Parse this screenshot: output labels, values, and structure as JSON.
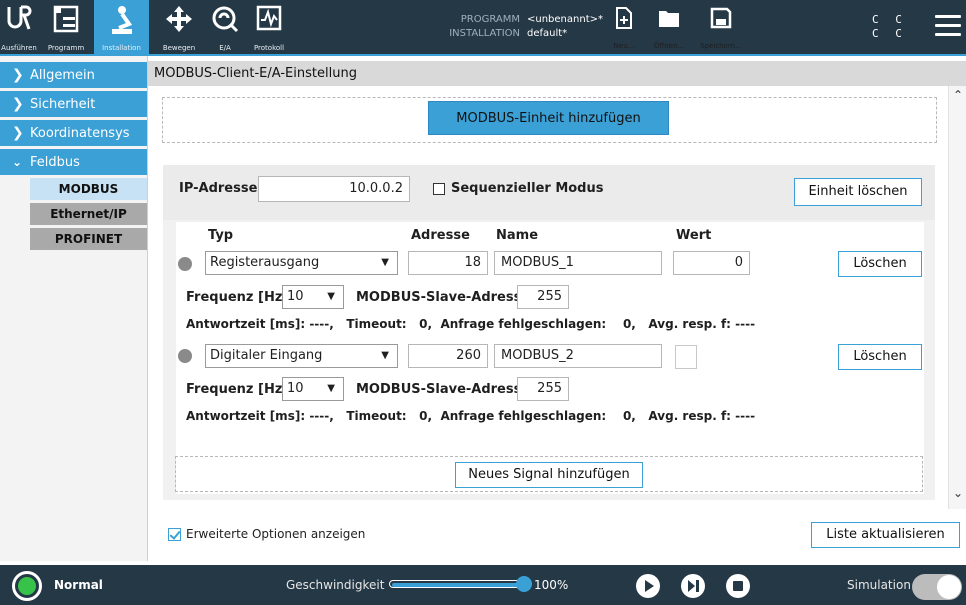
{
  "topbar": {
    "tabs": [
      {
        "label": "Ausführen",
        "icon": "ur-logo-icon"
      },
      {
        "label": "Programm",
        "icon": "program-icon"
      },
      {
        "label": "Installation",
        "icon": "installation-icon",
        "active": true
      }
    ],
    "tools": [
      {
        "label": "Bewegen",
        "icon": "move-icon"
      },
      {
        "label": "E/A",
        "icon": "io-icon"
      },
      {
        "label": "Protokoll",
        "icon": "log-icon"
      }
    ],
    "program_label": "PROGRAMM",
    "program_value": "<unbenannt>*",
    "installation_label": "INSTALLATION",
    "installation_value": "default*",
    "file_buttons": [
      {
        "label": "Neu...",
        "icon": "new-file-icon"
      },
      {
        "label": "Öffnen...",
        "icon": "folder-icon"
      },
      {
        "label": "Speichern...",
        "icon": "save-icon"
      }
    ],
    "cc_lines": [
      "C C",
      "C C"
    ]
  },
  "sidebar": {
    "items": [
      {
        "label": "Allgemein",
        "expanded": false
      },
      {
        "label": "Sicherheit",
        "expanded": false
      },
      {
        "label": "Koordinatensys",
        "expanded": false
      },
      {
        "label": "Feldbus",
        "expanded": true
      }
    ],
    "subitems": [
      {
        "label": "MODBUS",
        "active": true
      },
      {
        "label": "Ethernet/IP",
        "active": false
      },
      {
        "label": "PROFINET",
        "active": false
      }
    ]
  },
  "main": {
    "title": "MODBUS-Client-E/A-Einstellung",
    "add_unit_label": "MODBUS-Einheit hinzufügen",
    "unit": {
      "ip_label": "IP-Adresse",
      "ip_value": "10.0.0.2",
      "sequential_label": "Sequenzieller Modus",
      "sequential_checked": false,
      "delete_unit_label": "Einheit löschen",
      "columns": {
        "type": "Typ",
        "address": "Adresse",
        "name": "Name",
        "value": "Wert"
      },
      "signals": [
        {
          "type": "Registerausgang",
          "address": "18",
          "name": "MODBUS_1",
          "value": "0",
          "delete_label": "Löschen",
          "freq_label": "Frequenz [Hz]",
          "freq_value": "10",
          "slave_label": "MODBUS-Slave-Adresse",
          "slave_value": "255",
          "stats": {
            "response_label": "Antwortzeit [ms]:",
            "response_value": "----,",
            "timeout_label": "Timeout:",
            "timeout_value": "0,",
            "failed_label": "Anfrage fehlgeschlagen:",
            "failed_value": "0,",
            "avg_label": "Avg. resp. f:",
            "avg_value": "----"
          }
        },
        {
          "type": "Digitaler Eingang",
          "address": "260",
          "name": "MODBUS_2",
          "value": "",
          "delete_label": "Löschen",
          "freq_label": "Frequenz [Hz]",
          "freq_value": "10",
          "slave_label": "MODBUS-Slave-Adresse",
          "slave_value": "255",
          "stats": {
            "response_label": "Antwortzeit [ms]:",
            "response_value": "----,",
            "timeout_label": "Timeout:",
            "timeout_value": "0,",
            "failed_label": "Anfrage fehlgeschlagen:",
            "failed_value": "0,",
            "avg_label": "Avg. resp. f:",
            "avg_value": "----"
          }
        }
      ],
      "add_signal_label": "Neues Signal hinzufügen"
    },
    "advanced_label": "Erweiterte Optionen anzeigen",
    "advanced_checked": true,
    "refresh_label": "Liste aktualisieren"
  },
  "bottombar": {
    "status": "Normal",
    "speed_label": "Geschwindigkeit",
    "speed_value": "100%",
    "speed_fraction": 1.0,
    "simulation_label": "Simulation",
    "simulation_on": false
  },
  "colors": {
    "accent": "#3aa0d6",
    "topbar_bg": "#253846",
    "status_ok": "#37c24a"
  }
}
